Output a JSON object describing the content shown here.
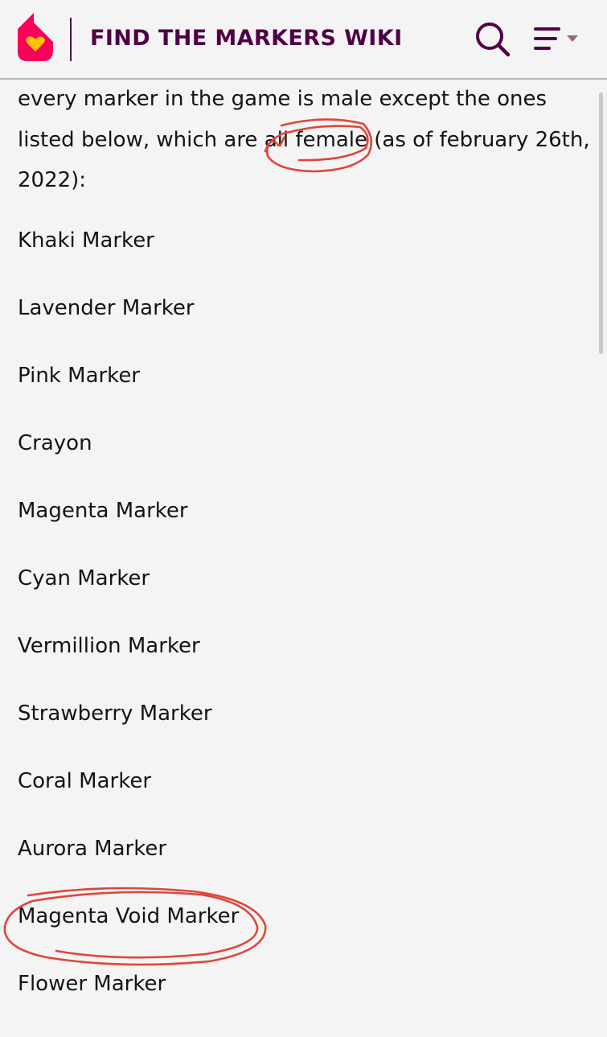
{
  "header": {
    "site_title": "FIND THE MARKERS WIKI",
    "logo_icon": "fandom-flame-heart-logo",
    "search_icon": "search-icon",
    "menu_icon": "menu-icon",
    "colors": {
      "brand": "#520044",
      "logo_orange": "#fa005a",
      "logo_yellow": "#ffc500"
    }
  },
  "content": {
    "intro_part1": "every marker in the game is male except the ones listed below, which are ",
    "intro_struck": "all",
    "intro_circled": "female",
    "intro_part2": " (as of february 26th, 2022):",
    "markers": [
      "Khaki Marker",
      "Lavender Marker",
      "Pink Marker",
      "Crayon",
      "Magenta Marker",
      "Cyan Marker",
      "Vermillion Marker",
      "Strawberry Marker",
      "Coral Marker",
      "Aurora Marker",
      "Magenta Void Marker",
      "Flower Marker"
    ]
  },
  "annotations": {
    "pen_color": "#e0453a"
  }
}
